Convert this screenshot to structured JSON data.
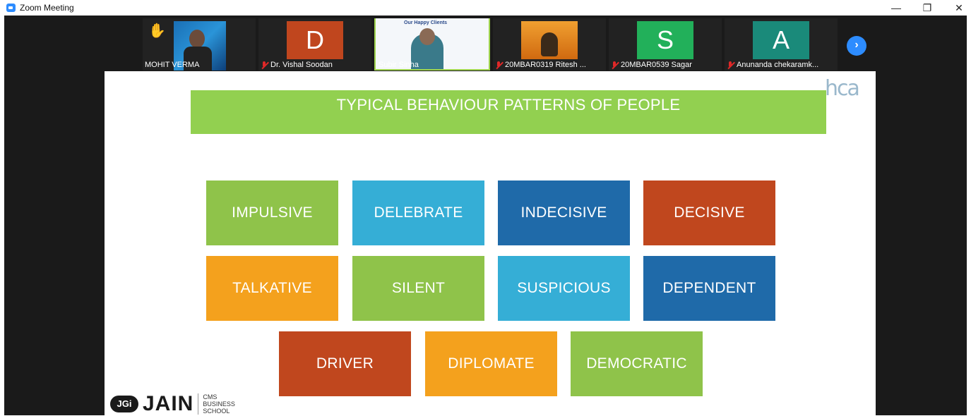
{
  "window": {
    "title": "Zoom Meeting",
    "minimize_glyph": "—",
    "maximize_glyph": "❐",
    "close_glyph": "✕"
  },
  "participants": [
    {
      "name": "MOHIT VERMA",
      "muted": false,
      "hand_raised": true,
      "hand_glyph": "✋",
      "type": "video"
    },
    {
      "name": "Dr. Vishal Soodan",
      "muted": true,
      "avatar_letter": "D",
      "avatar_color": "#c0461e",
      "type": "avatar"
    },
    {
      "name": "Subir Sinha",
      "muted": false,
      "active_speaker": true,
      "type": "video",
      "shared_heading": "Our Happy Clients"
    },
    {
      "name": "20MBAR0319 Ritesh ...",
      "muted": true,
      "type": "video"
    },
    {
      "name": "20MBAR0539 Sagar",
      "muted": true,
      "avatar_letter": "S",
      "avatar_color": "#22b05a",
      "type": "avatar"
    },
    {
      "name": "Anunanda chekaramk...",
      "muted": true,
      "avatar_letter": "A",
      "avatar_color": "#1a8a7a",
      "type": "avatar"
    }
  ],
  "next_page_glyph": "›",
  "slide": {
    "title": "TYPICAL BEHAVIOUR PATTERNS OF PEOPLE",
    "logo_text": "hca",
    "boxes": [
      {
        "label": "IMPULSIVE",
        "color": "#8fc34a"
      },
      {
        "label": "DELEBRATE",
        "color": "#35aed6"
      },
      {
        "label": "INDECISIVE",
        "color": "#1f6aa9"
      },
      {
        "label": "DECISIVE",
        "color": "#c0471e"
      },
      {
        "label": "TALKATIVE",
        "color": "#f4a11d"
      },
      {
        "label": "SILENT",
        "color": "#8fc34a"
      },
      {
        "label": "SUSPICIOUS",
        "color": "#35aed6"
      },
      {
        "label": "DEPENDENT",
        "color": "#1f6aa9"
      },
      {
        "label": "DRIVER",
        "color": "#c0471e"
      },
      {
        "label": "DIPLOMATE",
        "color": "#f4a11d"
      },
      {
        "label": "DEMOCRATIC",
        "color": "#8fc34a"
      }
    ],
    "footer": {
      "jgi": "JGi",
      "jain": "JAIN",
      "cms_line1": "CMS",
      "cms_line2": "BUSINESS",
      "cms_line3": "SCHOOL"
    }
  }
}
